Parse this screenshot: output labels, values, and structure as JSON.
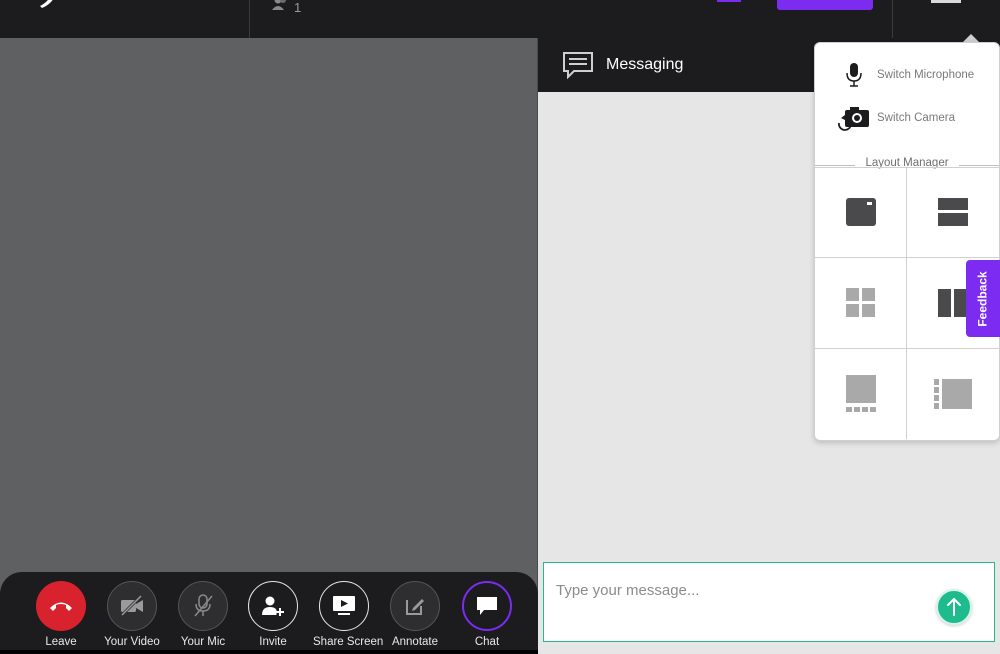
{
  "topbar": {
    "participant_count": "1"
  },
  "chat": {
    "title": "Messaging",
    "input_placeholder": "Type your message...",
    "input_value": ""
  },
  "dropdown": {
    "switch_microphone": "Switch Microphone",
    "switch_camera": "Switch Camera",
    "layout_manager_title": "Layout Manager",
    "layouts": [
      "single-speaker-layout-icon",
      "stacked-two-layout-icon",
      "grid-four-layout-icon",
      "side-by-side-layout-icon",
      "speaker-filmstrip-bottom-layout-icon",
      "speaker-filmstrip-left-layout-icon"
    ]
  },
  "feedback": {
    "label": "Feedback"
  },
  "toolbar": {
    "leave": "Leave",
    "your_video": "Your Video",
    "your_mic": "Your Mic",
    "invite": "Invite",
    "share_screen": "Share Screen",
    "annotate": "Annotate",
    "chat": "Chat"
  },
  "colors": {
    "accent_purple": "#7b2cf0",
    "leave_red": "#d8232f",
    "send_green": "#1dbb8e",
    "input_border": "#2bb58a",
    "dark_bg": "#1c1c1e",
    "video_bg": "#5f6062"
  }
}
